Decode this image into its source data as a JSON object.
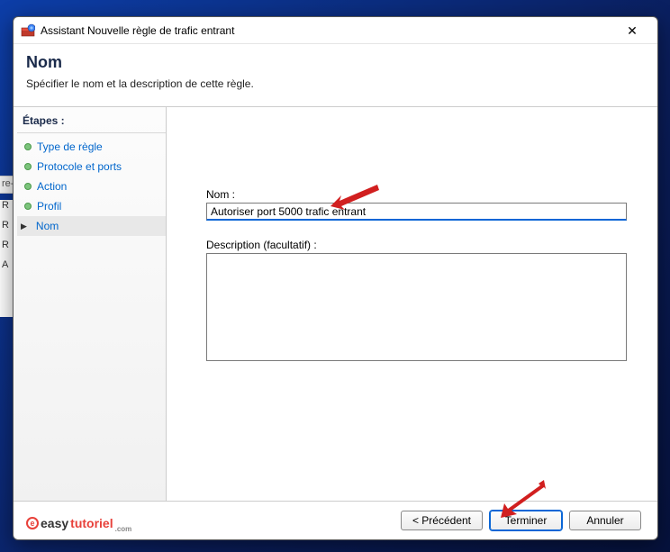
{
  "window": {
    "title": "Assistant Nouvelle règle de trafic entrant"
  },
  "header": {
    "title": "Nom",
    "subtitle": "Spécifier le nom et la description de cette règle."
  },
  "steps": {
    "heading": "Étapes :",
    "items": [
      {
        "label": "Type de règle",
        "current": false
      },
      {
        "label": "Protocole et ports",
        "current": false
      },
      {
        "label": "Action",
        "current": false
      },
      {
        "label": "Profil",
        "current": false
      },
      {
        "label": "Nom",
        "current": true
      }
    ]
  },
  "form": {
    "name_label": "Nom :",
    "name_value": "Autoriser port 5000 trafic entrant",
    "description_label": "Description (facultatif) :",
    "description_value": ""
  },
  "footer": {
    "back": "< Précédent",
    "finish": "Terminer",
    "cancel": "Annuler"
  },
  "watermark": {
    "brand_prefix": "easy",
    "brand_suffix": "tutoriel",
    "tld": ".com"
  },
  "background_rows": [
    "R",
    "R",
    "R",
    "A"
  ]
}
